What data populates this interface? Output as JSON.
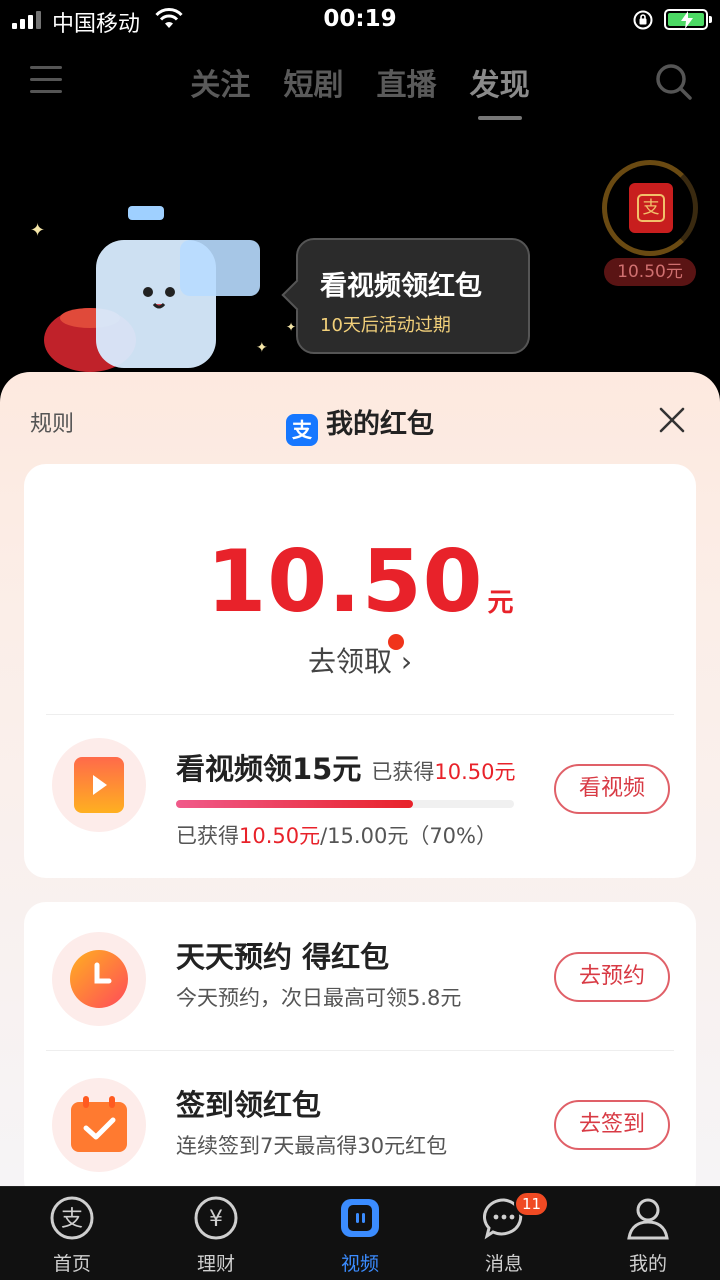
{
  "status_bar": {
    "carrier": "中国移动",
    "time": "00:19"
  },
  "top_nav": {
    "tabs": [
      {
        "label": "关注"
      },
      {
        "label": "短剧"
      },
      {
        "label": "直播"
      },
      {
        "label": "发现"
      }
    ],
    "active_tab": "发现"
  },
  "promo_bubble": {
    "title": "看视频领红包",
    "subtitle": "10天后活动过期"
  },
  "side_reward": {
    "envelope_glyph": "支",
    "amount": "10.50元"
  },
  "sheet": {
    "rules_label": "规则",
    "title": "我的红包",
    "alipay_glyph": "支",
    "balance": {
      "value": "10.50",
      "unit": "元",
      "claim_label": "去领取",
      "claim_arrow": "›"
    },
    "tasks": [
      {
        "title": "看视频领15元",
        "earned_prefix": "已获得",
        "earned_value": "10.50元",
        "progress_fraction": 0.7,
        "detail_prefix": "已获得",
        "detail_value": "10.50元",
        "detail_suffix": "/15.00元（70%）",
        "button": "看视频"
      },
      {
        "title": "天天预约 得红包",
        "subtitle": "今天预约，次日最高可领5.8元",
        "button": "去预约"
      },
      {
        "title": "签到领红包",
        "subtitle": "连续签到7天最高得30元红包",
        "button": "去签到"
      }
    ]
  },
  "tab_bar": {
    "items": [
      {
        "label": "首页",
        "icon": "alipay-home-icon"
      },
      {
        "label": "理财",
        "icon": "yuan-icon"
      },
      {
        "label": "视频",
        "icon": "video-icon"
      },
      {
        "label": "消息",
        "icon": "chat-icon",
        "badge": "11"
      },
      {
        "label": "我的",
        "icon": "person-icon"
      }
    ],
    "active": "视频",
    "home_glyph": "支",
    "wealth_glyph": "¥"
  },
  "colors": {
    "accent_red": "#e8222a",
    "tab_active_blue": "#3b8cff",
    "alipay_blue": "#1677ff"
  }
}
